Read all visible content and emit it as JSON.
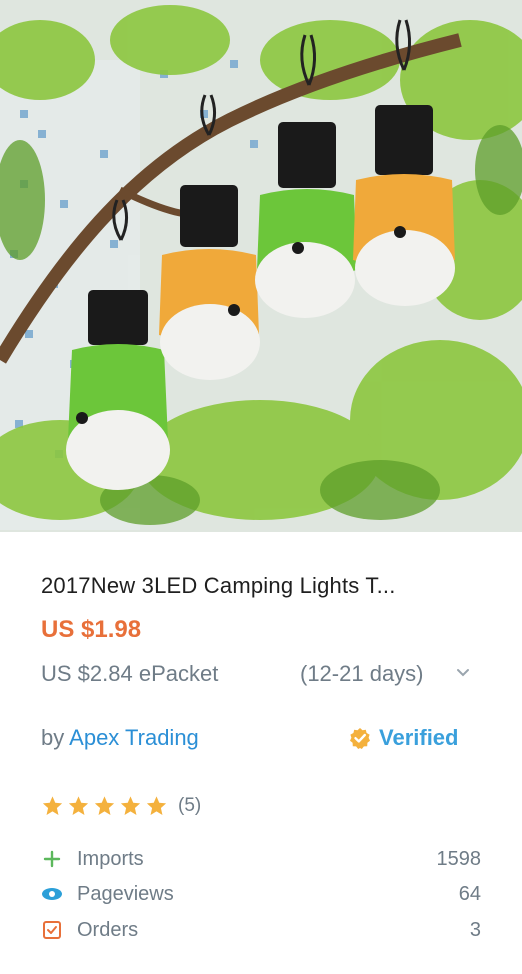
{
  "product": {
    "title": "2017New 3LED Camping Lights T...",
    "price": "US $1.98",
    "shipping_price": "US $2.84 ePacket",
    "shipping_days": "(12-21 days)"
  },
  "seller": {
    "by_label": "by",
    "name": "Apex Trading",
    "verified_label": "Verified"
  },
  "rating": {
    "stars": 5,
    "count": "(5)"
  },
  "stats": [
    {
      "label": "Imports",
      "value": "1598",
      "icon": "plus-icon"
    },
    {
      "label": "Pageviews",
      "value": "64",
      "icon": "eye-icon"
    },
    {
      "label": "Orders",
      "value": "3",
      "icon": "checklist-icon"
    }
  ],
  "colors": {
    "price": "#e8703a",
    "link": "#2b8fd6",
    "verified": "#3aa0dc",
    "badge": "#f4b13d",
    "star": "#f4b13d",
    "green": "#5cb85c"
  }
}
